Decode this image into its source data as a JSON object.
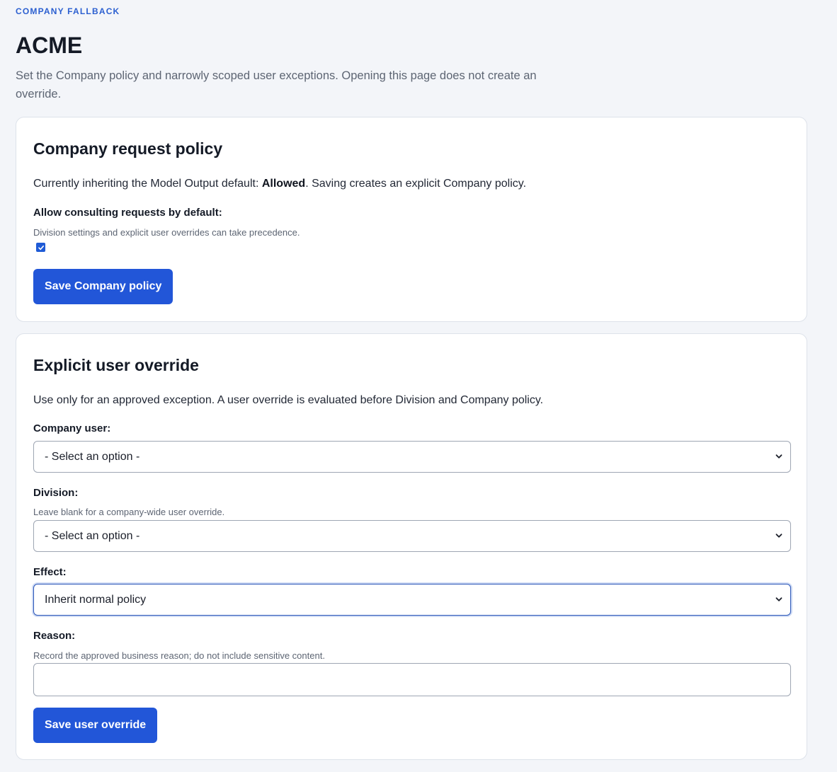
{
  "header": {
    "eyebrow": "COMPANY FALLBACK",
    "title": "ACME",
    "intro": "Set the Company policy and narrowly scoped user exceptions. Opening this page does not create an override."
  },
  "company_policy": {
    "heading": "Company request policy",
    "status_prefix": "Currently inheriting the Model Output default: ",
    "status_value": "Allowed",
    "status_suffix": ". Saving creates an explicit Company policy.",
    "checkbox_label": "Allow consulting requests by default:",
    "checkbox_help": "Division settings and explicit user overrides can take precedence.",
    "checkbox_checked": true,
    "save_label": "Save Company policy"
  },
  "user_override": {
    "heading": "Explicit user override",
    "description": "Use only for an approved exception. A user override is evaluated before Division and Company policy.",
    "user_label": "Company user:",
    "user_value": "- Select an option -",
    "division_label": "Division:",
    "division_help": "Leave blank for a company-wide user override.",
    "division_value": "- Select an option -",
    "effect_label": "Effect:",
    "effect_value": "Inherit normal policy",
    "reason_label": "Reason:",
    "reason_help": "Record the approved business reason; do not include sensitive content.",
    "reason_value": "",
    "save_label": "Save user override"
  },
  "colors": {
    "accent": "#2256d8",
    "eyebrow": "#2b5fd0",
    "background": "#f3f5f9"
  }
}
